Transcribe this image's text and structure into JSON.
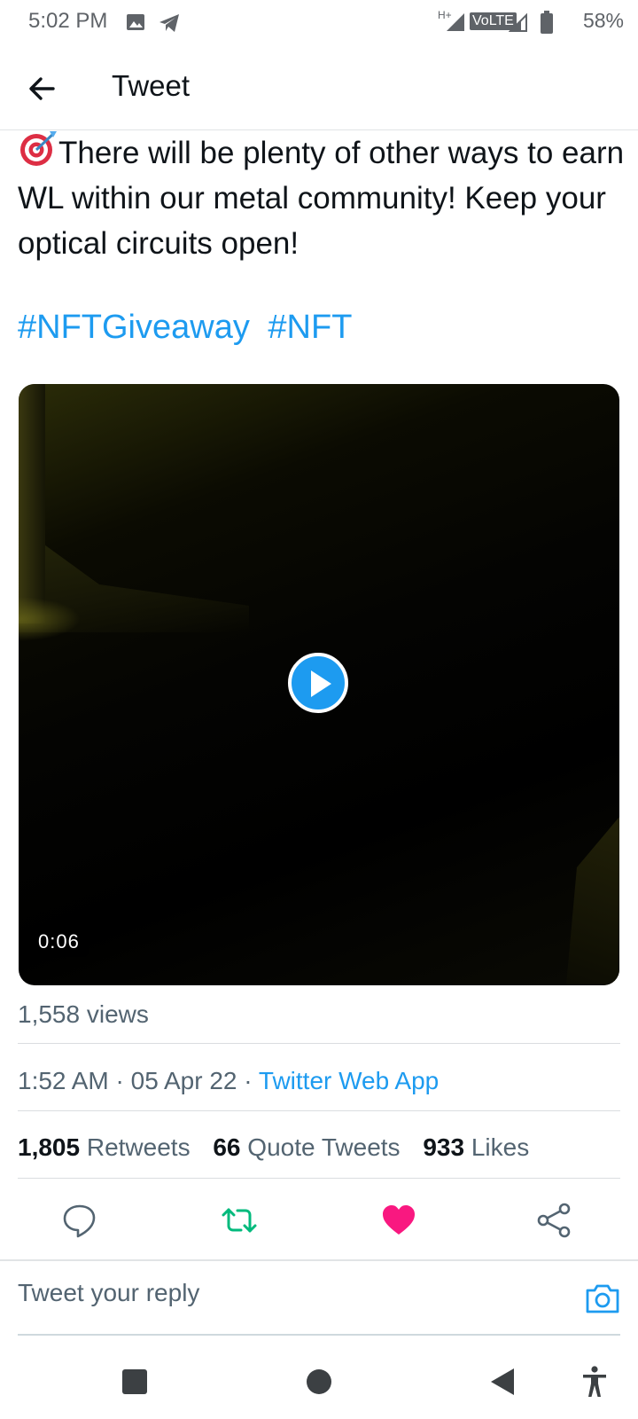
{
  "status_bar": {
    "time": "5:02 PM",
    "network": "H+",
    "volte": "VoLTE",
    "battery": "58%"
  },
  "header": {
    "title": "Tweet",
    "back_icon": "arrow-left-icon"
  },
  "tweet": {
    "emoji": "direct-hit-target-icon",
    "text": "There will be plenty of other ways to earn WL within our metal community! Keep your optical circuits open!",
    "hashtags": [
      "#NFTGiveaway",
      "#NFT"
    ]
  },
  "video": {
    "duration": "0:06",
    "play_icon": "play-icon"
  },
  "views": "1,558 views",
  "meta": {
    "time": "1:52 AM",
    "separator": "·",
    "date": "05 Apr 22",
    "source": "Twitter Web App"
  },
  "stats": {
    "retweets_count": "1,805",
    "retweets_label": "Retweets",
    "quotes_count": "66",
    "quotes_label": "Quote Tweets",
    "likes_count": "933",
    "likes_label": "Likes"
  },
  "actions": {
    "reply_icon": "reply-bubble-icon",
    "retweet_icon": "retweet-icon",
    "like_icon": "heart-icon",
    "share_icon": "share-icon",
    "retweet_color": "#00ba7c",
    "like_color": "#f91880"
  },
  "reply": {
    "placeholder": "Tweet your reply",
    "camera_icon": "camera-icon"
  },
  "colors": {
    "accent": "#1d9bf0",
    "text": "#0f1419",
    "secondary": "#536471"
  }
}
